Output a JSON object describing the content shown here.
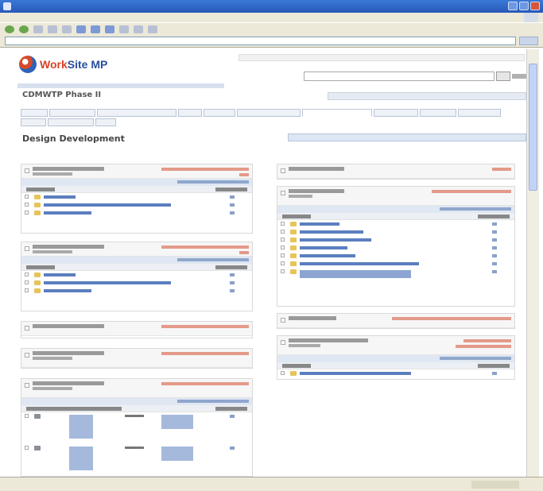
{
  "window": {
    "title": "",
    "colors": {
      "titlebar": "#2a62c8",
      "chrome": "#ece9d8"
    }
  },
  "menubar": {
    "items": []
  },
  "page": {
    "logo_text_a": "Work",
    "logo_text_b": "Site MP",
    "project_title": "CDMWTP Phase II",
    "section_title": "Design Development"
  },
  "panels_left": [
    {
      "rows": 3
    },
    {
      "rows": 3
    },
    {
      "rows": 0
    },
    {
      "rows": 0
    },
    {
      "rows": 2
    }
  ],
  "panels_right": [
    {
      "rows": 0
    },
    {
      "rows": 8
    },
    {
      "rows": 0
    },
    {
      "rows": 1
    }
  ]
}
